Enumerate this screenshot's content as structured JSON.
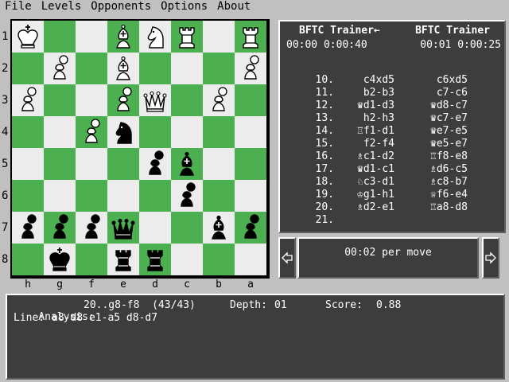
{
  "menu": [
    "File",
    "Levels",
    "Opponents",
    "Options",
    "About"
  ],
  "board": {
    "light_color": "#ececec",
    "dark_color": "#4caf50",
    "rank_labels": [
      "1",
      "2",
      "3",
      "4",
      "5",
      "6",
      "7",
      "8"
    ],
    "file_labels": [
      "h",
      "g",
      "f",
      "e",
      "d",
      "c",
      "b",
      "a"
    ],
    "rows": [
      [
        "wK",
        "",
        "",
        "wB",
        "wN",
        "wR",
        "",
        "wR"
      ],
      [
        "",
        "wP",
        "",
        "wB",
        "",
        "",
        "",
        "wP"
      ],
      [
        "wP",
        "",
        "",
        "wP",
        "wQ",
        "",
        "wP",
        ""
      ],
      [
        "",
        "",
        "wP",
        "bN",
        "",
        "",
        "",
        ""
      ],
      [
        "",
        "",
        "",
        "",
        "bP",
        "bB",
        "",
        ""
      ],
      [
        "",
        "",
        "",
        "",
        "",
        "bP",
        "",
        ""
      ],
      [
        "bP",
        "bP",
        "bP",
        "bQ",
        "",
        "",
        "bB",
        "bP"
      ],
      [
        "",
        "bK",
        "",
        "bR",
        "bR",
        "",
        "",
        ""
      ]
    ]
  },
  "players": {
    "white": "BFTC Trainer←",
    "black": "BFTC Trainer"
  },
  "clocks": {
    "white": "00:00  0:00:40",
    "black": "00:01  0:00:25"
  },
  "moves": [
    {
      "num": "10.",
      "white": "c4xd5",
      "black": "c6xd5"
    },
    {
      "num": "11.",
      "white": "b2-b3",
      "black": "c7-c6"
    },
    {
      "num": "12.",
      "white": "♛d1-d3",
      "black": "♛d8-c7"
    },
    {
      "num": "13.",
      "white": "h2-h3",
      "black": "♛c7-e7"
    },
    {
      "num": "14.",
      "white": "♖f1-d1",
      "black": "♛e7-e5"
    },
    {
      "num": "15.",
      "white": "f2-f4",
      "black": "♛e5-e7"
    },
    {
      "num": "16.",
      "white": "♗c1-d2",
      "black": "♖f8-e8"
    },
    {
      "num": "17.",
      "white": "♛d1-c1",
      "black": "♗d6-c5"
    },
    {
      "num": "18.",
      "white": "♘c3-d1",
      "black": "♗c8-b7"
    },
    {
      "num": "19.",
      "white": "♔g1-h1",
      "black": "♕f6-e4"
    },
    {
      "num": "20.",
      "white": "♗d2-e1",
      "black": "♖a8-d8"
    },
    {
      "num": "21.",
      "white": "",
      "black": ""
    }
  ],
  "per_move": "00:02 per move",
  "analysis": {
    "label": "Analysis:",
    "value": "20..g8-f8  (43/43)",
    "depth_label": "Depth:",
    "depth": "01",
    "score_label": "Score:",
    "score": "0.88",
    "line_label": "Line:",
    "line": "a8-d8 e1-a5 d8-d7"
  }
}
